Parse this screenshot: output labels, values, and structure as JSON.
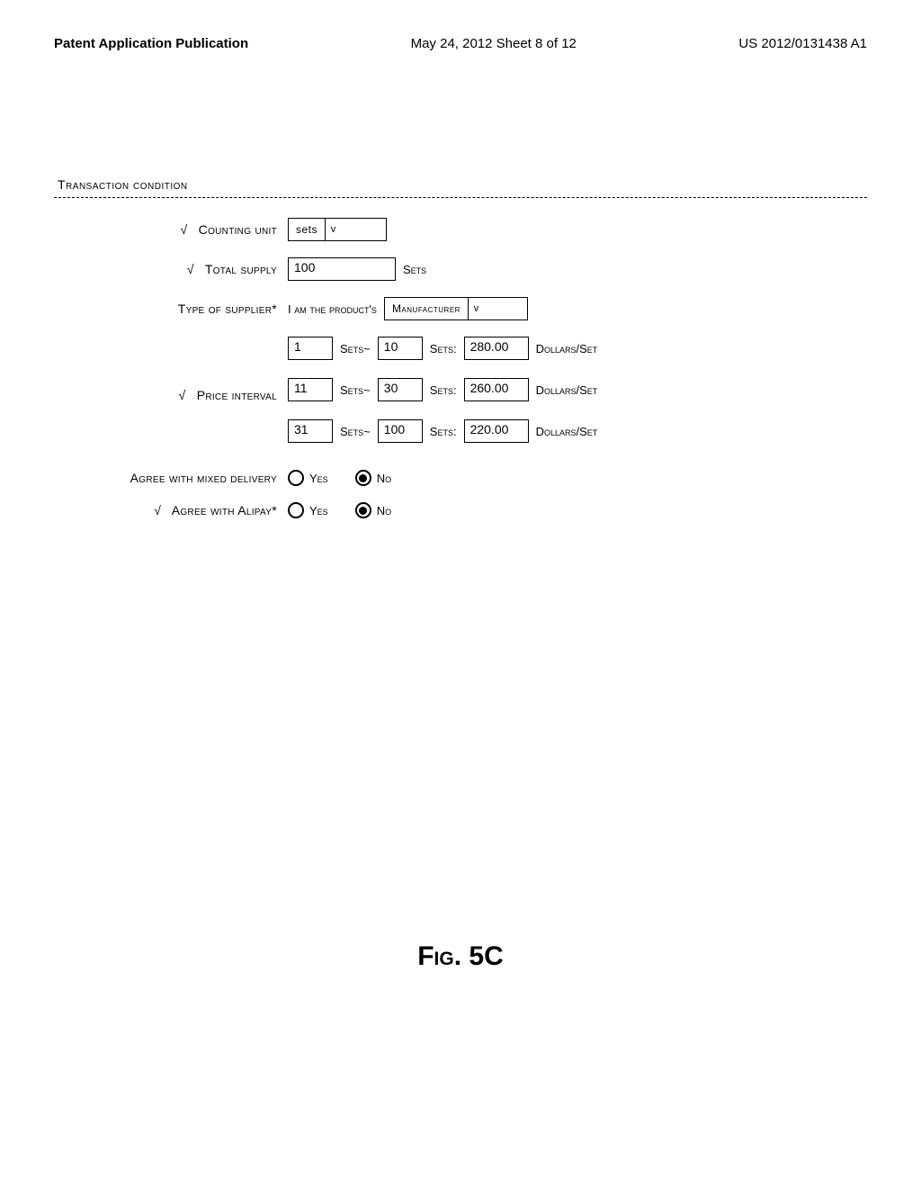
{
  "header": {
    "left": "Patent Application Publication",
    "center": "May 24, 2012  Sheet 8 of 12",
    "right": "US 2012/0131438 A1"
  },
  "section_title": "Transaction condition",
  "form": {
    "counting_unit": {
      "label": "Counting unit",
      "checked": "√",
      "value": "sets"
    },
    "total_supply": {
      "label": "Total supply",
      "checked": "√",
      "value": "100",
      "unit": "Sets"
    },
    "supplier_type": {
      "label": "Type of supplier*",
      "prefix": "I am the product's",
      "value": "Manufacturer"
    },
    "price_interval": {
      "label": "Price interval",
      "checked": "√",
      "sets_word": "Sets~",
      "sets_colon": "Sets:",
      "unit": "Dollars/Set",
      "rows": [
        {
          "from": "1",
          "to": "10",
          "price": "280.00"
        },
        {
          "from": "11",
          "to": "30",
          "price": "260.00"
        },
        {
          "from": "31",
          "to": "100",
          "price": "220.00"
        }
      ]
    },
    "mixed_delivery": {
      "label": "Agree with mixed delivery",
      "yes": "Yes",
      "no": "No",
      "selected": "no"
    },
    "alipay": {
      "label": "Agree with Alipay*",
      "checked": "√",
      "yes": "Yes",
      "no": "No",
      "selected": "no"
    }
  },
  "figure_label": "Fig. 5C"
}
